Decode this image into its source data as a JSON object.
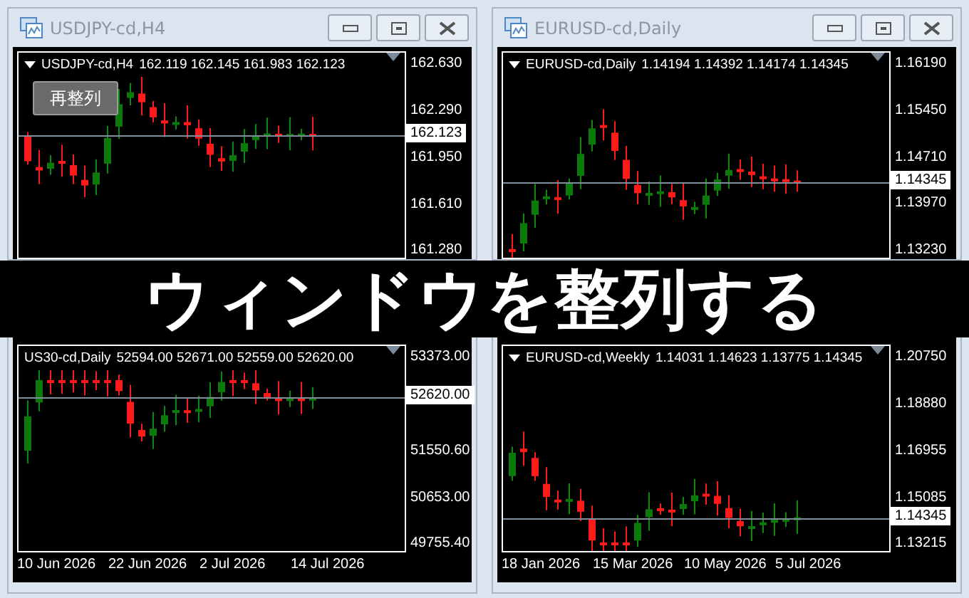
{
  "windows": [
    {
      "title": "USDJPY-cd,H4",
      "header": {
        "menu_arrow": true,
        "symbol": "USDJPY-cd,H4",
        "ohlc": "162.119 162.145 161.983 162.123"
      },
      "price_axis": [
        "162.630",
        "162.290",
        "161.950",
        "161.610",
        "161.280"
      ],
      "current_price": "162.123",
      "button": "再整列"
    },
    {
      "title": "EURUSD-cd,Daily",
      "header": {
        "menu_arrow": true,
        "symbol": "EURUSD-cd,Daily",
        "ohlc": "1.14194 1.14392 1.14174 1.14345"
      },
      "price_axis": [
        "1.16190",
        "1.15450",
        "1.14710",
        "1.13970",
        "1.13230"
      ],
      "current_price": "1.14345"
    },
    {
      "header": {
        "menu_arrow": false,
        "symbol": "US30-cd,Daily",
        "ohlc": "52594.00 52671.00 52559.00 52620.00"
      },
      "price_axis": [
        "53373.00",
        "51550.60",
        "50653.00",
        "49755.40"
      ],
      "current_price": "52620.00",
      "date_axis": [
        "10 Jun 2026",
        "22 Jun 2026",
        "2 Jul 2026",
        "14 Jul 2026"
      ]
    },
    {
      "header": {
        "menu_arrow": true,
        "symbol": "EURUSD-cd,Weekly",
        "ohlc": "1.14031 1.14623 1.13775 1.14345"
      },
      "price_axis": [
        "1.20750",
        "1.18880",
        "1.16955",
        "1.15085",
        "1.13215"
      ],
      "current_price": "1.14345",
      "date_axis": [
        "18 Jan 2026",
        "15 Mar 2026",
        "10 May 2026",
        "5 Jul 2026"
      ]
    }
  ],
  "banner": "ウィンドウを整列する"
}
